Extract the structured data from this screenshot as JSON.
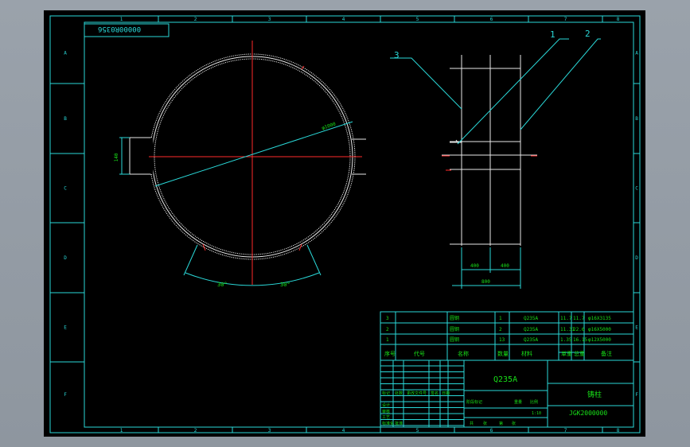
{
  "grid": {
    "cols": [
      "1",
      "2",
      "3",
      "4",
      "5",
      "6",
      "7",
      "8"
    ],
    "rows": [
      "A",
      "B",
      "C",
      "D",
      "E",
      "F"
    ]
  },
  "drawing_number_top": "00000R0356",
  "dims": {
    "diameter": "φ1000",
    "gap": "140",
    "angle_left": "30°",
    "angle_right": "30°",
    "width_a": "400",
    "width_b": "400",
    "width_total": "800"
  },
  "callouts": [
    "1",
    "2",
    "3"
  ],
  "bom": {
    "rows": [
      {
        "no": "3",
        "name": "圆钢",
        "qty": "1",
        "mat": "Q235A",
        "w1": "11.7",
        "w2": "11.7",
        "note": "φ16X3135"
      },
      {
        "no": "2",
        "name": "圆钢",
        "qty": "2",
        "mat": "Q235A",
        "w1": "11.31",
        "w2": "22.6",
        "note": "φ16X5000"
      },
      {
        "no": "1",
        "name": "圆钢",
        "qty": "13",
        "mat": "Q235A",
        "w1": "1.35",
        "w2": "16.15",
        "note": "φ12X5000"
      }
    ],
    "header": [
      "序号",
      "代号",
      "名称",
      "数量",
      "材料",
      "单重",
      "总重",
      "备注"
    ]
  },
  "title_block": {
    "material": "Q235A",
    "part_name": "铸柱",
    "drawing_no": "JGK2000000",
    "scale": "1:10",
    "labels": [
      "标记",
      "处数",
      "更改文件号",
      "签名",
      "日期",
      "设计",
      "审核",
      "工艺",
      "标准化",
      "批准",
      "阶段标记",
      "重量",
      "比例",
      "共",
      "张",
      "第",
      "张"
    ]
  }
}
